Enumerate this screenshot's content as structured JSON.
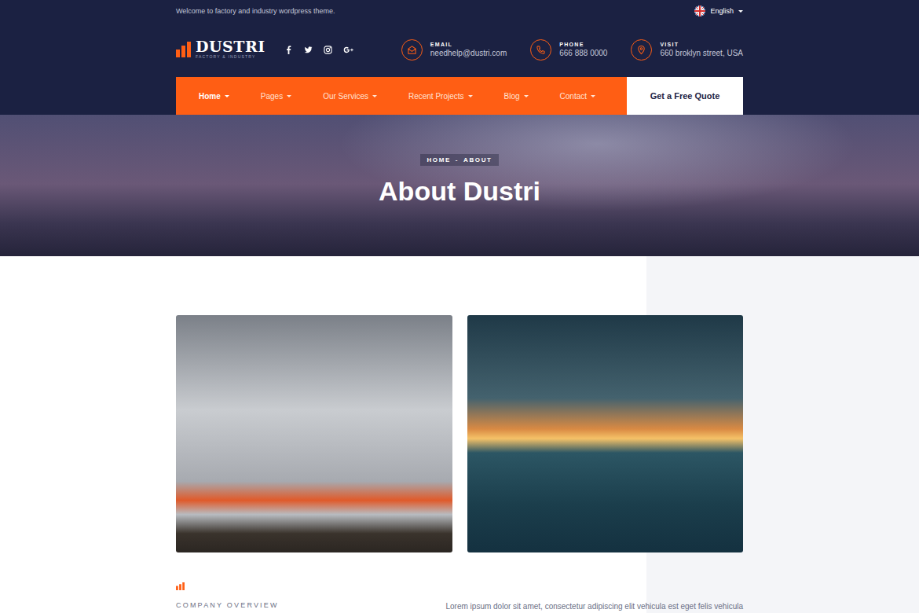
{
  "topbar": {
    "welcome": "Welcome to factory and industry wordpress theme.",
    "language": "English"
  },
  "logo": {
    "name": "DUSTRI",
    "tagline": "FACTORY & INDUSTRY"
  },
  "contacts": [
    {
      "kind": "email",
      "label": "EMAIL",
      "value": "needhelp@dustri.com"
    },
    {
      "kind": "phone",
      "label": "PHONE",
      "value": "666 888 0000"
    },
    {
      "kind": "visit",
      "label": "VISIT",
      "value": "660 broklyn street, USA"
    }
  ],
  "nav": {
    "items": [
      {
        "label": "Home",
        "selected": true
      },
      {
        "label": "Pages",
        "selected": false
      },
      {
        "label": "Our Services",
        "selected": false
      },
      {
        "label": "Recent Projects",
        "selected": false
      },
      {
        "label": "Blog",
        "selected": false
      },
      {
        "label": "Contact",
        "selected": false
      }
    ],
    "quote_button": "Get a Free Quote"
  },
  "hero": {
    "breadcrumb": [
      "HOME",
      "ABOUT"
    ],
    "separator": "-",
    "title": "About Dustri"
  },
  "overview": {
    "label": "COMPANY OVERVIEW",
    "text": "Lorem ipsum dolor sit amet, consectetur adipiscing elit vehicula est eget felis vehicula"
  }
}
